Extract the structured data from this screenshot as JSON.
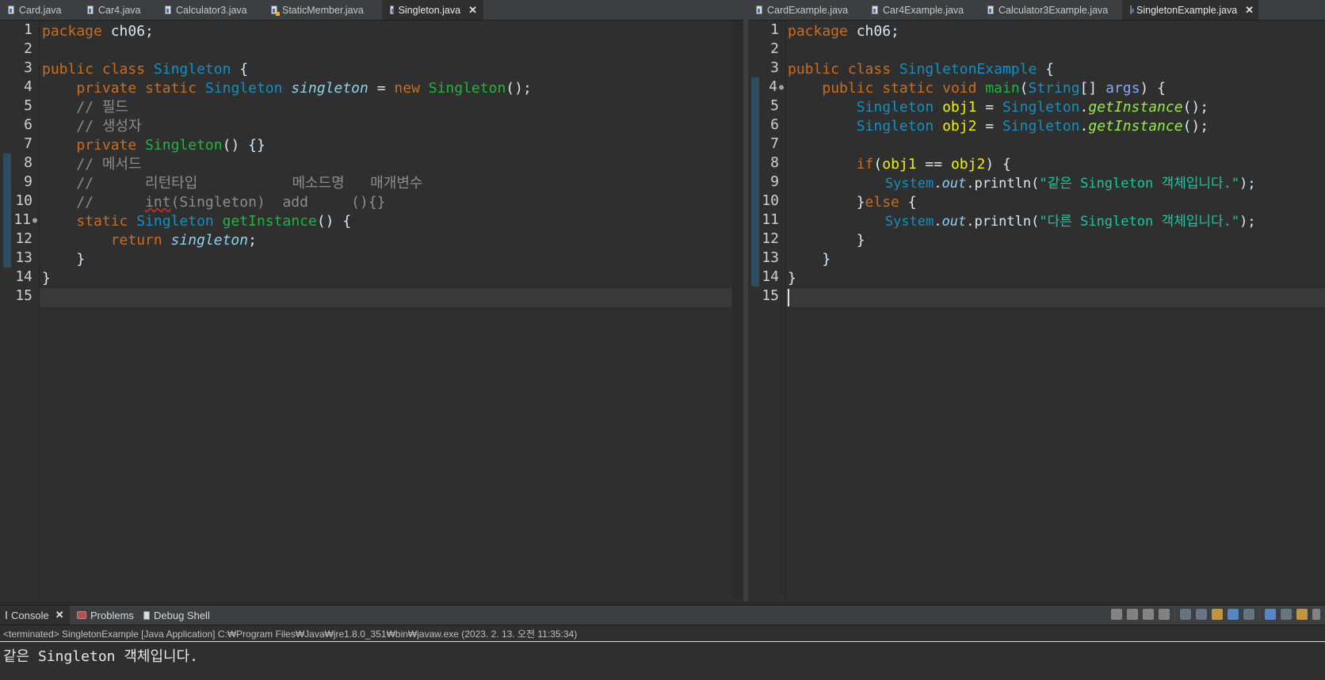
{
  "left_editor": {
    "tabs": [
      {
        "label": "Card.java",
        "active": false
      },
      {
        "label": "Car4.java",
        "active": false
      },
      {
        "label": "Calculator3.java",
        "active": false
      },
      {
        "label": "StaticMember.java",
        "active": false
      },
      {
        "label": "Singleton.java",
        "active": true
      }
    ],
    "line_numbers": [
      "1",
      "2",
      "3",
      "4",
      "5",
      "6",
      "7",
      "8",
      "9",
      "10",
      "11",
      "12",
      "13",
      "14",
      "15"
    ],
    "code": {
      "l1_kw": "package",
      "l1_rest": " ch06;",
      "l3_kw1": "public",
      "l3_kw2": "class",
      "l3_cls": "Singleton",
      "l3_rest": " {",
      "l4_kw1": "private",
      "l4_kw2": "static",
      "l4_ty": "Singleton",
      "l4_field": "singleton",
      "l4_eq": " = ",
      "l4_kw3": "new",
      "l4_cls": "Singleton",
      "l4_rest": "();",
      "l5_cm": "// 필드",
      "l6_cm": "// 생성자",
      "l7_kw": "private",
      "l7_cls": "Singleton",
      "l7_rest": "() {}",
      "l8_cm": "// 메서드",
      "l9_cm": "//      리턴타입           메소드명   매개변수",
      "l10_cm_a": "//      ",
      "l10_cm_b": "int",
      "l10_cm_c": "(Singleton)  add     (){}",
      "l11_kw": "static",
      "l11_ty": "Singleton",
      "l11_m": "getInstance",
      "l11_rest": "() {",
      "l12_kw": "return",
      "l12_field": "singleton",
      "l12_rest": ";",
      "l13": "}",
      "l14": "}"
    }
  },
  "right_editor": {
    "tabs": [
      {
        "label": "CardExample.java",
        "active": false
      },
      {
        "label": "Car4Example.java",
        "active": false
      },
      {
        "label": "Calculator3Example.java",
        "active": false
      },
      {
        "label": "SingletonExample.java",
        "active": true
      }
    ],
    "line_numbers": [
      "1",
      "2",
      "3",
      "4",
      "5",
      "6",
      "7",
      "8",
      "9",
      "10",
      "11",
      "12",
      "13",
      "14",
      "15"
    ],
    "code": {
      "l1_kw": "package",
      "l1_rest": " ch06;",
      "l3_kw1": "public",
      "l3_kw2": "class",
      "l3_cls": "SingletonExample",
      "l3_rest": " {",
      "l4_kw1": "public",
      "l4_kw2": "static",
      "l4_kw3": "void",
      "l4_m": "main",
      "l4_p1": "(",
      "l4_ty": "String",
      "l4_p2": "[] ",
      "l4_param": "args",
      "l4_rest": ") {",
      "l5_ty": "Singleton",
      "l5_var": "obj1",
      "l5_eq": " = ",
      "l5_ty2": "Singleton",
      "l5_dot": ".",
      "l5_m": "getInstance",
      "l5_rest": "();",
      "l6_ty": "Singleton",
      "l6_var": "obj2",
      "l6_eq": " = ",
      "l6_ty2": "Singleton",
      "l6_dot": ".",
      "l6_m": "getInstance",
      "l6_rest": "();",
      "l8_kw": "if",
      "l8_p": "(",
      "l8_v1": "obj1",
      "l8_op": " == ",
      "l8_v2": "obj2",
      "l8_rest": ") {",
      "l9_ty": "System",
      "l9_dot": ".",
      "l9_f": "out",
      "l9_m": ".println(",
      "l9_str": "\"같은 Singleton 객체입니다.\"",
      "l9_rest": ");",
      "l10_a": "}",
      "l10_kw": "else",
      "l10_rest": " {",
      "l11_ty": "System",
      "l11_dot": ".",
      "l11_f": "out",
      "l11_m": ".println(",
      "l11_str": "\"다른 Singleton 객체입니다.\"",
      "l11_rest": ");",
      "l12": "}",
      "l13": "}",
      "l14": "}"
    }
  },
  "console": {
    "tabs": [
      {
        "label": "Console",
        "active": true
      },
      {
        "label": "Problems",
        "active": false
      },
      {
        "label": "Debug Shell",
        "active": false
      }
    ],
    "status": "<terminated> SingletonExample [Java Application] C:₩Program Files₩Java₩jre1.8.0_351₩bin₩javaw.exe (2023. 2. 13. 오전 11:35:34)",
    "output": "같은 Singleton 객체입니다."
  },
  "colors": {
    "keyword": "#cc6c1d",
    "type": "#1290c3",
    "class_decl": "#1eb540",
    "string": "#17c6a3",
    "comment": "#8d8d8d",
    "local_var": "#f2f200"
  }
}
